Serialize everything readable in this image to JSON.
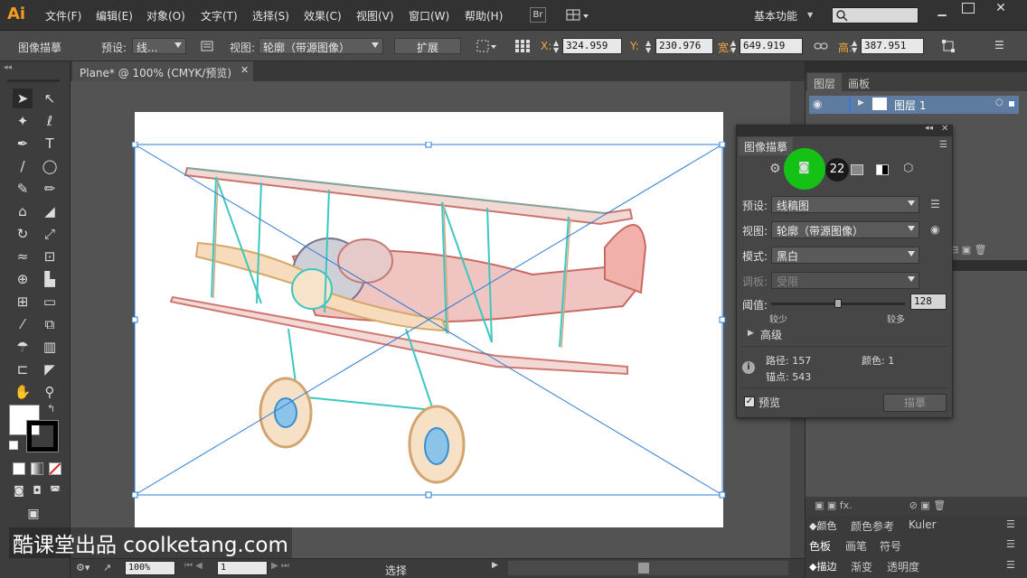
{
  "app": {
    "logo": "Ai",
    "menu": [
      "文件(F)",
      "编辑(E)",
      "对象(O)",
      "文字(T)",
      "选择(S)",
      "效果(C)",
      "视图(V)",
      "窗口(W)",
      "帮助(H)"
    ],
    "bridge_label": "Br",
    "workspace": "基本功能",
    "search_placeholder": ""
  },
  "control_bar": {
    "title": "图像描摹",
    "preset_label": "预设:",
    "preset_value": "线...",
    "view_label": "视图:",
    "view_value": "轮廓（带源图像）",
    "expand_button": "扩展",
    "x_label": "X:",
    "x_value": "324.959",
    "y_label": "Y:",
    "y_value": "230.976",
    "w_label": "宽:",
    "w_value": "649.919",
    "h_label": "高:",
    "h_value": "387.951"
  },
  "document": {
    "tab_title": "Plane* @ 100% (CMYK/预览)",
    "zoom": "100%",
    "page": "1",
    "status_text": "选择"
  },
  "layers_panel": {
    "tabs": [
      "图层",
      "画板"
    ],
    "layer_name": "图层 1"
  },
  "lower_panels": {
    "row1_tabs": [
      "颜色",
      "颜色参考",
      "Kuler"
    ],
    "row2_tabs": [
      "色板",
      "画笔",
      "符号"
    ],
    "row3_tabs": [
      "描边",
      "渐变",
      "透明度"
    ]
  },
  "trace_panel": {
    "title": "图像描摹",
    "badge_number": "22",
    "preset_label": "预设:",
    "preset_value": "线稿图",
    "view_label": "视图:",
    "view_value": "轮廓（带源图像）",
    "mode_label": "模式:",
    "mode_value": "黑白",
    "palette_label": "调板:",
    "palette_value": "受限",
    "threshold_label": "阈值:",
    "threshold_value": "128",
    "threshold_fraction": 0.5,
    "less_label": "较少",
    "more_label": "较多",
    "advanced_label": "高级",
    "paths_label": "路径: 157",
    "anchors_label": "锚点: 543",
    "colors_label": "颜色: 1",
    "preview_label": "预览",
    "trace_button": "描摹"
  },
  "watermark": "酷课堂出品 coolketang.com",
  "colors": {
    "accent_green": "#14c114",
    "selection_blue": "#2a7bd6"
  }
}
